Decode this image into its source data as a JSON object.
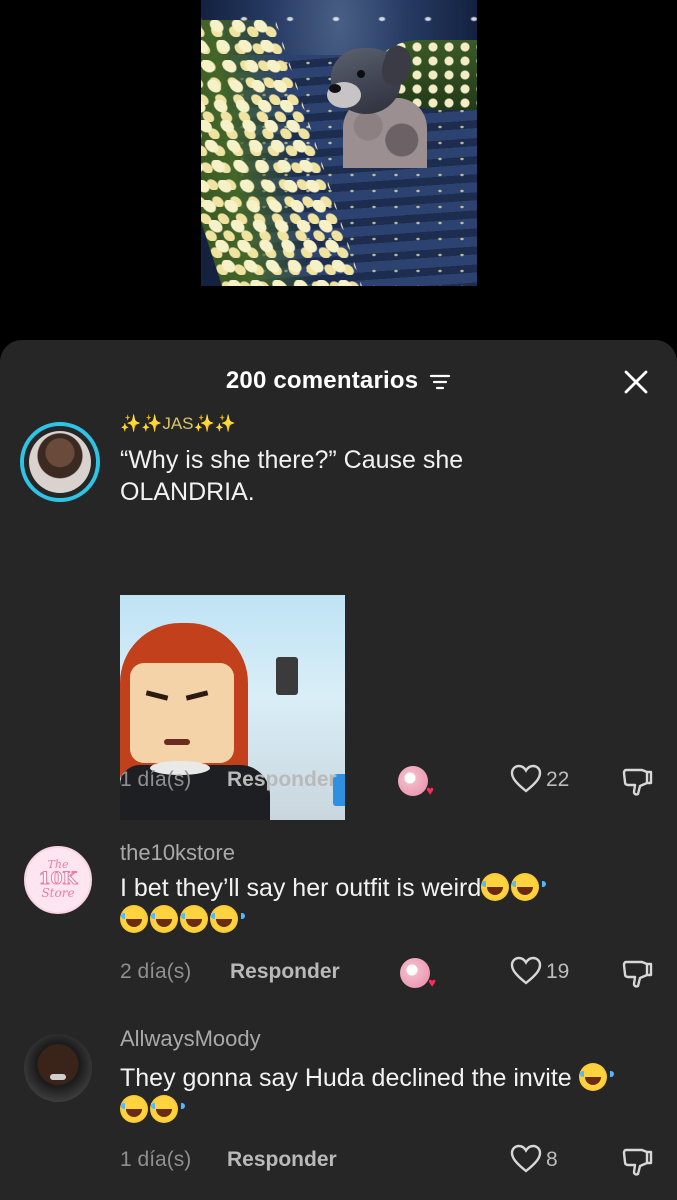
{
  "sheet": {
    "title": "200 comentarios",
    "filter_icon": "filter-lines-icon",
    "close_icon": "close-icon"
  },
  "comments": [
    {
      "username": "✨✨JAS✨✨",
      "text": "“Why is she there?” Cause she OLANDRIA.",
      "time": "1 día(s)",
      "reply": "Responder",
      "likes": "22",
      "has_sticker": true
    },
    {
      "username": "the10kstore",
      "text": "I bet they’ll say her outfit is weird",
      "emoji_count_line1": 2,
      "emoji_count_line2": 4,
      "time": "2 día(s)",
      "reply": "Responder",
      "likes": "19"
    },
    {
      "username": "AllwaysMoody",
      "text": "They gonna say Huda declined the invite",
      "emoji_count": 3,
      "time": "1 día(s)",
      "reply": "Responder",
      "likes": "8"
    }
  ],
  "avatar_logo_text": {
    "top": "The",
    "mid": "10K",
    "bottom": "Store"
  },
  "colors": {
    "sheet_bg": "#262626",
    "story_ring": "#2ec4e6",
    "liker_heart": "#ff2d55",
    "username": "#a9a9a9"
  }
}
